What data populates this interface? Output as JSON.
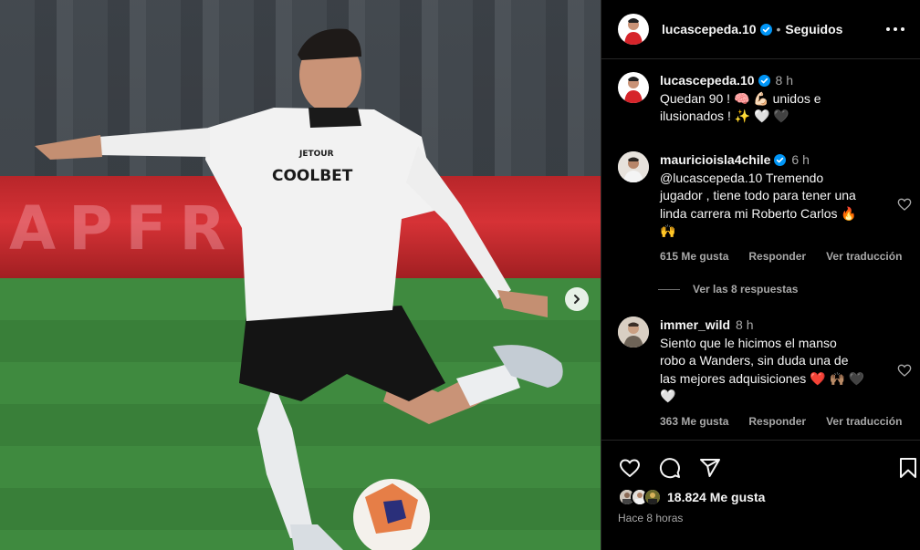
{
  "post": {
    "author": "lucascepeda.10",
    "follow_status": "Seguidos",
    "caption": {
      "username": "lucascepeda.10",
      "time": "8 h",
      "line1": "Quedan 90 ! 🧠 💪🏻  unidos e",
      "line2": "ilusionados ! ✨ 🤍 🖤"
    }
  },
  "media": {
    "board_text": "APFRE",
    "jersey_sponsor": "COOLBET",
    "jersey_sponsor2": "JETOUR"
  },
  "comments": [
    {
      "username": "mauricioisla4chile",
      "time": "6 h",
      "lines": [
        "@lucascepeda.10 Tremendo",
        "jugador , tiene todo para tener una",
        "linda carrera mi Roberto Carlos 🔥",
        "🙌"
      ],
      "likes": "615 Me gusta",
      "reply": "Responder",
      "translate": "Ver traducción"
    },
    {
      "username": "immer_wild",
      "time": "8 h",
      "lines": [
        "Siento que le hicimos el manso",
        "robo a Wanders, sin duda una de",
        "las mejores adquisiciones ❤️ 🙌🏽 🖤",
        "🤍"
      ],
      "likes": "363 Me gusta",
      "reply": "Responder",
      "translate": "Ver traducción"
    }
  ],
  "view_replies": "Ver las 8 respuestas",
  "footer": {
    "likes": "18.824 Me gusta",
    "posted": "Hace 8 horas"
  },
  "icons": [
    "verified-badge-icon",
    "more-options-icon",
    "heart-icon",
    "comment-icon",
    "share-icon",
    "bookmark-icon",
    "chevron-right-icon"
  ],
  "colors": {
    "background": "#000000",
    "verified": "#0095f6",
    "secondary_text": "#a8a8a8",
    "divider": "#262626"
  }
}
